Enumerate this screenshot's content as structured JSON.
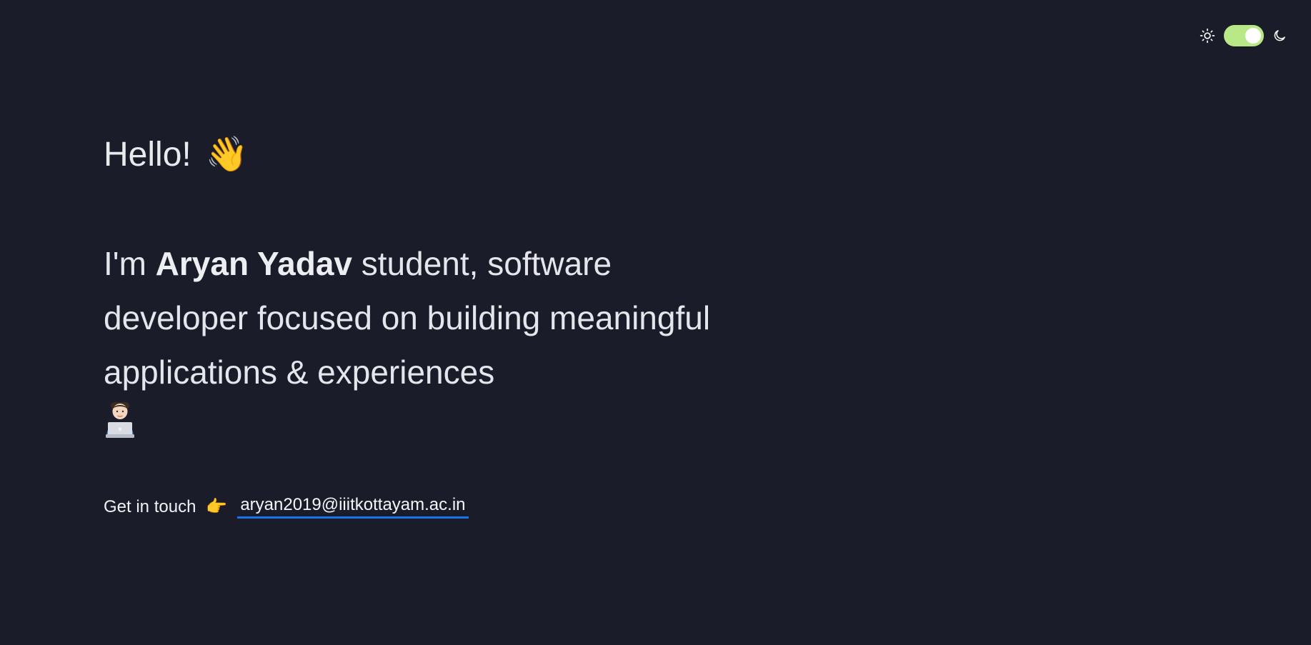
{
  "theme_toggle": {
    "light_icon": "sun-icon",
    "dark_icon": "moon-icon",
    "state": "on",
    "track_color": "#b8e986",
    "knob_color": "#ffffff"
  },
  "hero": {
    "greeting": "Hello!",
    "greeting_emoji": "👋",
    "intro_prefix": "I'm ",
    "name": "Aryan Yadav",
    "intro_text": " student, software developer focused on building meaningful applications & experiences",
    "intro_emoji": "laptop-person-emoji"
  },
  "contact": {
    "label": "Get in touch",
    "pointer_emoji": "👉",
    "email": "aryan2019@iiitkottayam.ac.in",
    "underline_color": "#1a73e8"
  },
  "colors": {
    "background": "#1a1d29",
    "text": "#e4e6eb"
  }
}
